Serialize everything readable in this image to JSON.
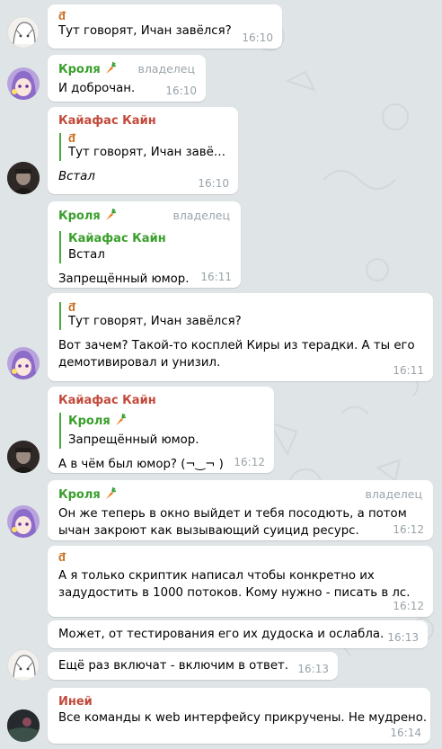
{
  "messages": [
    {
      "glyph": "ᵭ̃",
      "text": "Тут говорят, Ичан завёлся?",
      "time": "16:10"
    },
    {
      "sender": "Кроля",
      "role": "владелец",
      "text": "И доброчан.",
      "time": "16:10"
    },
    {
      "sender": "Кайафас Кайн",
      "reply_glyph": "ᵭ̃",
      "reply_text": "Тут говорят, Ичан завё…",
      "text": "Встал",
      "time": "16:10"
    },
    {
      "sender": "Кроля",
      "role": "владелец",
      "reply_name": "Кайафас Кайн",
      "reply_text": "Встал",
      "text": "Запрещённый юмор.",
      "time": "16:11"
    },
    {
      "reply_glyph": "ᵭ̃",
      "reply_text": "Тут говорят, Ичан завёлся?",
      "text_line1": "Вот зачем? Такой-то косплей Киры из терадки. А ты его",
      "text_line2": "демотивировал и унизил.",
      "time": "16:11"
    },
    {
      "sender": "Кайафас Кайн",
      "reply_name": "Кроля",
      "reply_text": "Запрещённый юмор.",
      "text": "А в чём был юмор? (¬‿¬ )",
      "time": "16:12"
    },
    {
      "sender": "Кроля",
      "role": "владелец",
      "text_line1": "Он же теперь в окно выйдет и тебя посодють, а потом",
      "text_line2": "ычан закроют как вызывающий суицид ресурс.",
      "time": "16:12"
    },
    {
      "glyph": "ᵭ̃",
      "text_line1": "А я только скриптик написал чтобы конкретно их",
      "text_line2": "задудостить в 1000 потоков. Кому нужно - писать в лс.",
      "time": "16:12"
    },
    {
      "text": "Может, от тестирования его их дудоска и ослабла.",
      "time": "16:13"
    },
    {
      "text": "Ещё раз включат - включим в ответ.",
      "time": "16:13"
    },
    {
      "sender": "Иней",
      "text": "Все команды к web интерфейсу прикручены. Не мудрено.",
      "time": "16:14"
    }
  ]
}
